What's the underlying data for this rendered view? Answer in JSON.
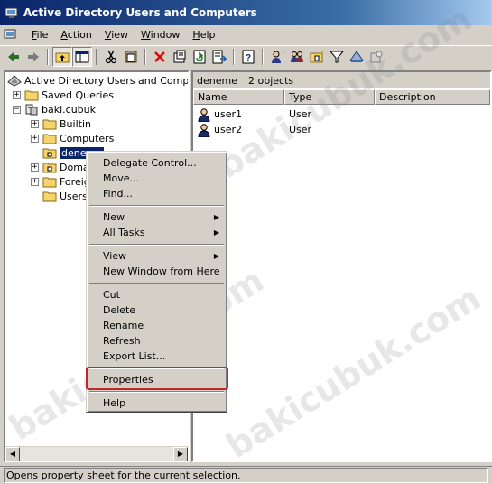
{
  "window": {
    "title": "Active Directory Users and Computers"
  },
  "menubar": [
    {
      "label": "File",
      "u": "F",
      "rest": "ile"
    },
    {
      "label": "Action",
      "u": "A",
      "rest": "ction"
    },
    {
      "label": "View",
      "u": "V",
      "rest": "iew"
    },
    {
      "label": "Window",
      "u": "W",
      "rest": "indow"
    },
    {
      "label": "Help",
      "u": "H",
      "rest": "elp"
    }
  ],
  "toolbar": {
    "icons": [
      "back-icon",
      "forward-icon",
      "up-folder-icon",
      "show-hide-tree-icon",
      "cut-icon",
      "copy-icon",
      "delete-icon",
      "properties-icon",
      "refresh-icon",
      "export-list-icon",
      "help-icon",
      "new-user-icon",
      "new-group-icon",
      "new-ou-icon",
      "filter-icon",
      "find-icon",
      "add-to-group-icon"
    ]
  },
  "tree": {
    "root": "Active Directory Users and Computer",
    "saved_queries": "Saved Queries",
    "domain": "baki.cubuk",
    "children": [
      "Builtin",
      "Computers",
      "deneme",
      "Domain Controllers",
      "ForeignSecurityPrincipals",
      "Users"
    ],
    "visible_children": [
      "Builtin",
      "Computers",
      "deneme",
      "Doma",
      "Foreig",
      "Users"
    ]
  },
  "details": {
    "current_container": "deneme",
    "object_count": "2 objects",
    "columns": [
      "Name",
      "Type",
      "Description"
    ],
    "rows": [
      {
        "name": "user1",
        "type": "User",
        "description": ""
      },
      {
        "name": "user2",
        "type": "User",
        "description": ""
      }
    ]
  },
  "context_menu": {
    "items": [
      {
        "label": "Delegate Control...",
        "submenu": false
      },
      {
        "label": "Move...",
        "submenu": false
      },
      {
        "label": "Find...",
        "submenu": false
      },
      {
        "label": "New",
        "submenu": true
      },
      {
        "label": "All Tasks",
        "submenu": true
      },
      {
        "label": "View",
        "submenu": true
      },
      {
        "label": "New Window from Here",
        "submenu": false
      },
      {
        "label": "Cut",
        "submenu": false
      },
      {
        "label": "Delete",
        "submenu": false
      },
      {
        "label": "Rename",
        "submenu": false
      },
      {
        "label": "Refresh",
        "submenu": false
      },
      {
        "label": "Export List...",
        "submenu": false
      },
      {
        "label": "Properties",
        "submenu": false,
        "highlighted": true
      },
      {
        "label": "Help",
        "submenu": false
      }
    ]
  },
  "status": {
    "text": "Opens property sheet for the current selection."
  },
  "watermark": {
    "text": "bakicubuk.com"
  },
  "colors": {
    "title_start": "#0a246a",
    "title_end": "#a6caf0",
    "selection": "#0a246a",
    "highlight_box": "#c0272d",
    "chrome": "#d4d0c8"
  }
}
